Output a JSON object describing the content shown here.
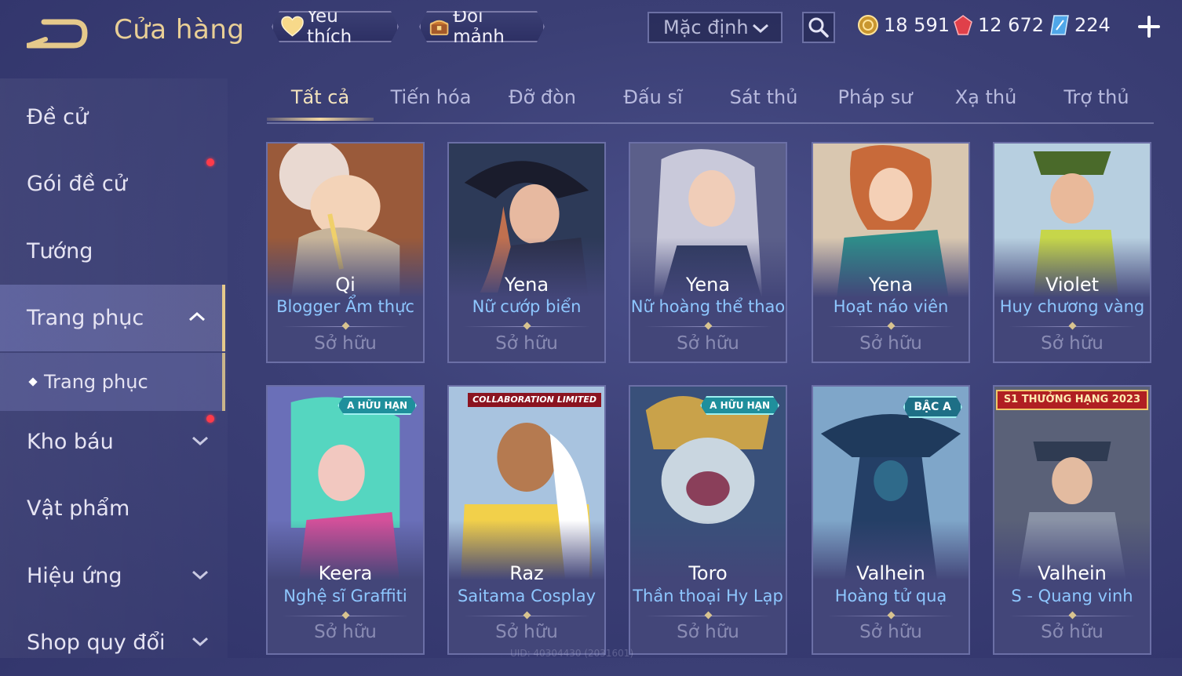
{
  "header": {
    "title": "Cửa hàng",
    "favorites_label": "Yêu thích",
    "exchange_label": "Đổi mảnh",
    "sort_value": "Mặc định",
    "currencies": {
      "gold": "18 591",
      "vouchers": "12 672",
      "diamonds": "224"
    }
  },
  "sidebar": {
    "items": [
      {
        "label": "Đề cử"
      },
      {
        "label": "Gói đề cử"
      },
      {
        "label": "Tướng"
      },
      {
        "label": "Trang phục"
      },
      {
        "label": "Trang phục"
      },
      {
        "label": "Kho báu"
      },
      {
        "label": "Vật phẩm"
      },
      {
        "label": "Hiệu ứng"
      },
      {
        "label": "Shop quy đổi"
      }
    ]
  },
  "tabs": [
    "Tất cả",
    "Tiến hóa",
    "Đỡ đòn",
    "Đấu sĩ",
    "Sát thủ",
    "Pháp sư",
    "Xạ thủ",
    "Trợ thủ"
  ],
  "owned_label": "Sở hữu",
  "cards": [
    {
      "hero": "Qi",
      "skin": "Blogger Ẩm thực"
    },
    {
      "hero": "Yena",
      "skin": "Nữ cướp biển"
    },
    {
      "hero": "Yena",
      "skin": "Nữ hoàng thể thao"
    },
    {
      "hero": "Yena",
      "skin": "Hoạt náo viên"
    },
    {
      "hero": "Violet",
      "skin": "Huy chương vàng"
    },
    {
      "hero": "Keera",
      "skin": "Nghệ sĩ Graffiti",
      "badge": "A HỮU HẠN"
    },
    {
      "hero": "Raz",
      "skin": "Saitama Cosplay",
      "badge": "COLLABORATION LIMITED"
    },
    {
      "hero": "Toro",
      "skin": "Thần thoại Hy Lạp",
      "badge": "A HỮU HẠN"
    },
    {
      "hero": "Valhein",
      "skin": "Hoàng tử quạ",
      "badge": "BẬC A"
    },
    {
      "hero": "Valhein",
      "skin": "S - Quang vinh",
      "badge": "S1 THƯỞNG HẠNG 2023"
    }
  ],
  "footer": {
    "uid": "UID: 40304430 (2031601)"
  },
  "colors": {
    "accent_gold": "#e9cf96",
    "skin_name_blue": "#8ec7ff",
    "notification_red": "#ff3b4a"
  }
}
